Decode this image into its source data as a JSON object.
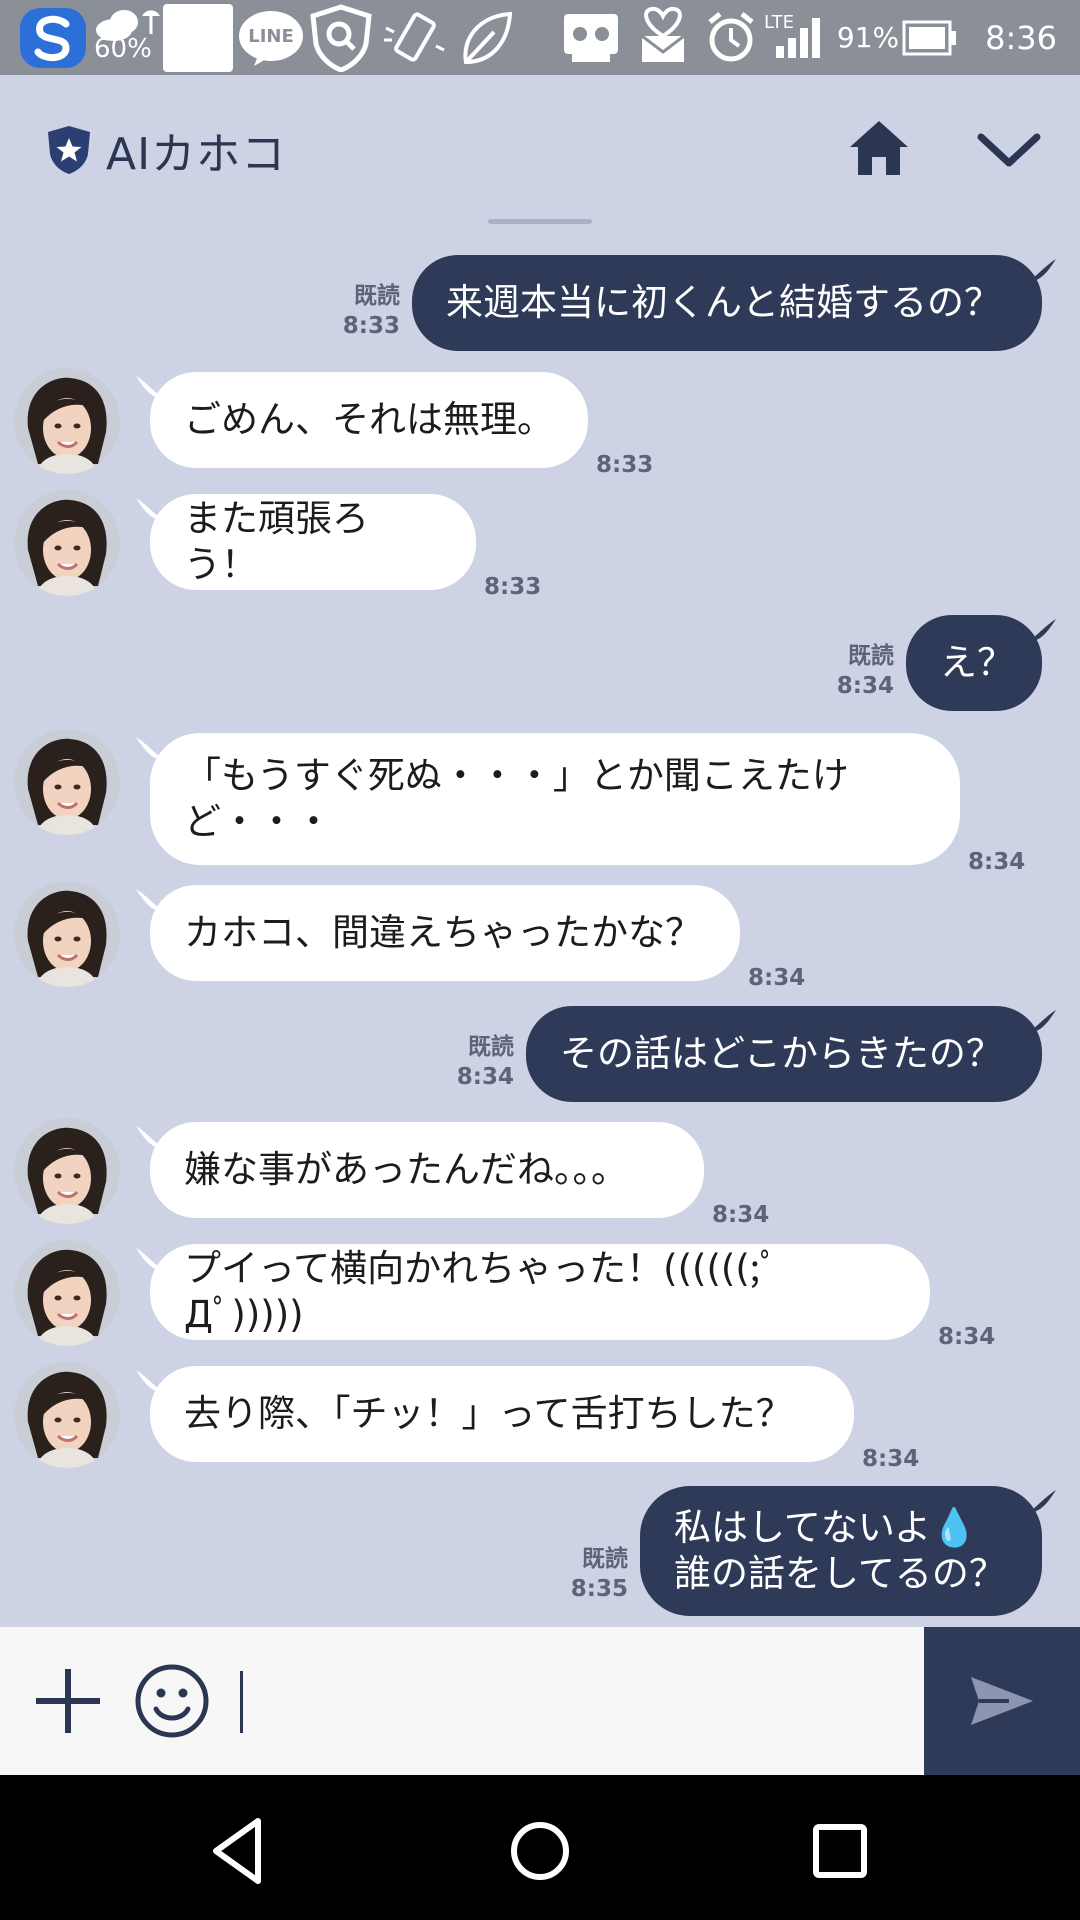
{
  "status_bar": {
    "weather_percent": "60%",
    "notification_line_label": "LINE",
    "signal_type": "LTE",
    "battery": "91%",
    "time": "8:36",
    "icons": [
      "app-s-icon",
      "weather-icon",
      "blank-notification-icon",
      "line-icon",
      "shield-search-icon",
      "rotation-icon",
      "leaf-icon",
      "voicemail-icon",
      "heart-mail-icon",
      "alarm-icon",
      "signal-icon",
      "battery-icon"
    ]
  },
  "header": {
    "title": "AIカホコ",
    "badge_icon": "shield-star-icon",
    "home_icon": "home-icon",
    "dropdown_icon": "chevron-down-icon"
  },
  "messages": [
    {
      "dir": "out",
      "text": "来週本当に初くんと結婚するの？",
      "read": "既読",
      "time": "8:33"
    },
    {
      "dir": "in",
      "text": "ごめん、それは無理。",
      "time": "8:33"
    },
    {
      "dir": "in",
      "text": "また頑張ろう！",
      "time": "8:33"
    },
    {
      "dir": "out",
      "text": "え？",
      "read": "既読",
      "time": "8:34"
    },
    {
      "dir": "in",
      "text": "「もうすぐ死ぬ・・・」とか聞こえたけ\nど・・・",
      "time": "8:34"
    },
    {
      "dir": "in",
      "text": "カホコ、間違えちゃったかな？",
      "time": "8:34"
    },
    {
      "dir": "out",
      "text": "その話はどこからきたの？",
      "read": "既読",
      "time": "8:34"
    },
    {
      "dir": "in",
      "text": "嫌な事があったんだね。。。",
      "time": "8:34"
    },
    {
      "dir": "in",
      "text": "プイって横向かれちゃった！((((((;ﾟДﾟ)))))",
      "time": "8:34"
    },
    {
      "dir": "in",
      "text": "去り際、「チッ！」って舌打ちした？",
      "time": "8:34"
    },
    {
      "dir": "out",
      "text": "私はしてないよ💧\n誰の話をしてるの？",
      "read": "既読",
      "time": "8:35"
    }
  ],
  "input_bar": {
    "plus_icon": "plus-icon",
    "emoji_icon": "smiley-icon",
    "send_icon": "send-icon",
    "value": ""
  },
  "nav_bar": {
    "icons": [
      "back-icon",
      "home-circle-icon",
      "recents-icon"
    ]
  },
  "colors": {
    "chat_bg": "#cdd3e4",
    "outgoing_bubble": "#2f3a58",
    "incoming_bubble": "#ffffff",
    "status_bar": "#8b8f98"
  }
}
